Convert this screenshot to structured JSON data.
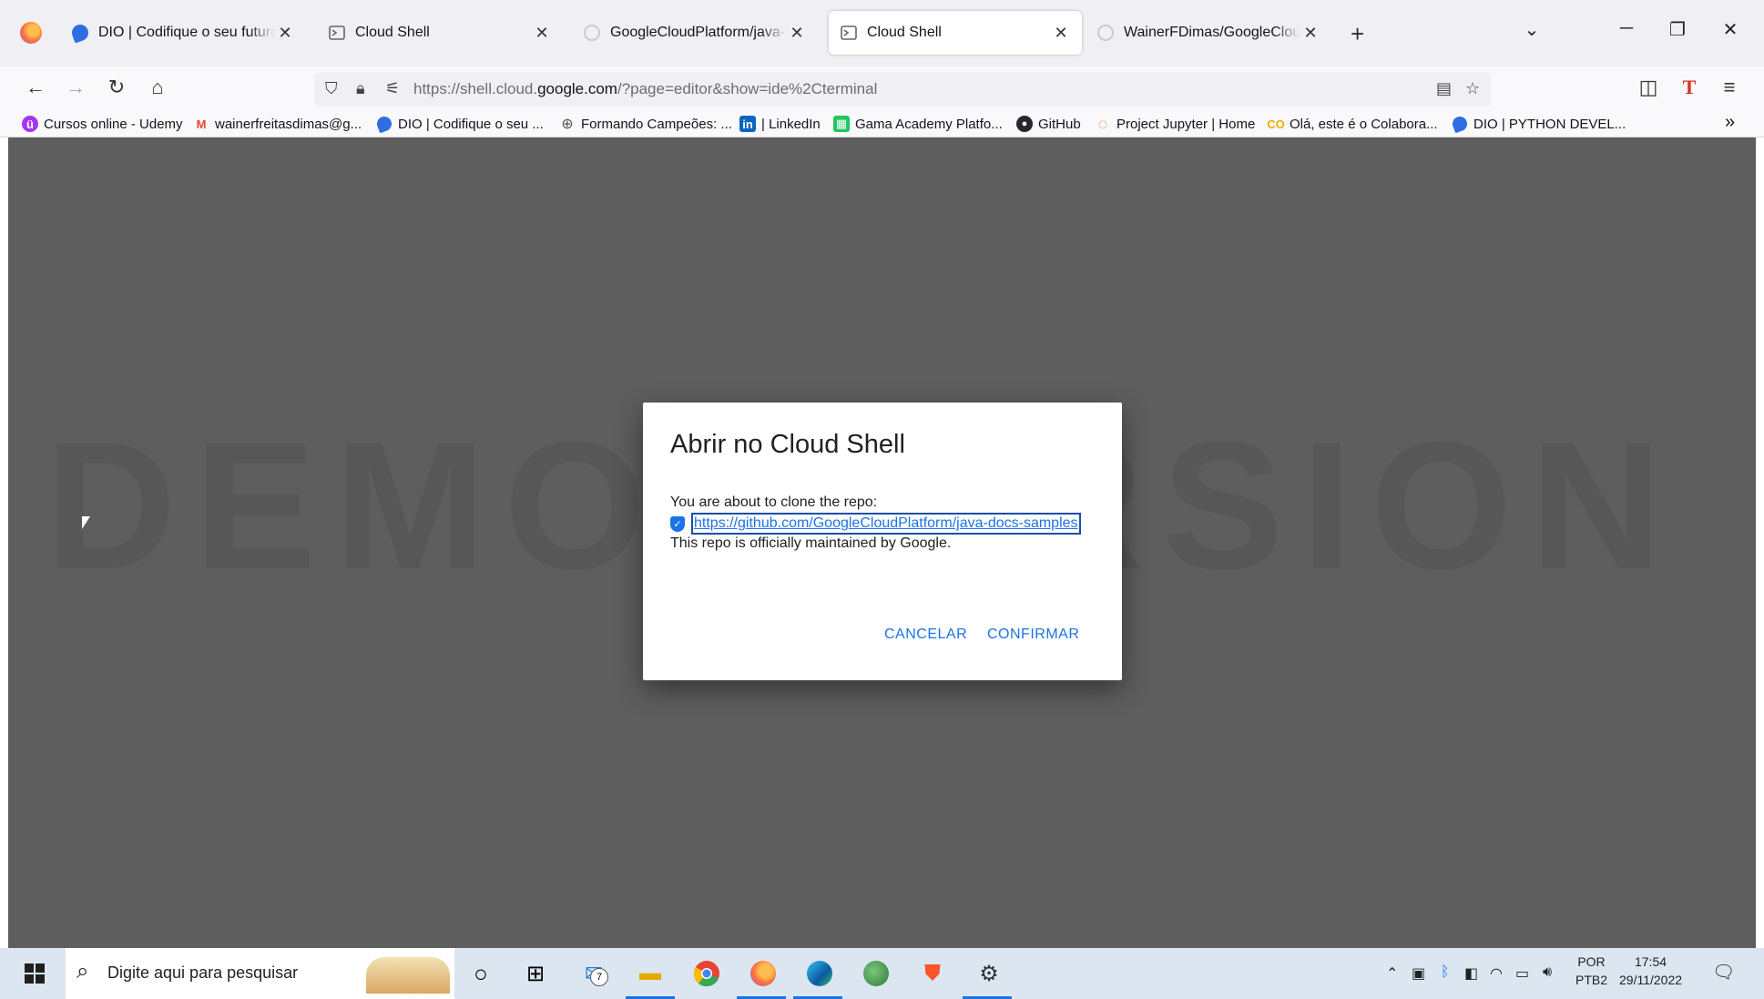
{
  "browser": {
    "tabs": [
      {
        "title": "DIO | Codifique o seu futuro global agora",
        "favicon": "dio-icon",
        "active": false
      },
      {
        "title": "Cloud Shell",
        "favicon": "cloud-shell-icon",
        "active": false
      },
      {
        "title": "GoogleCloudPlatform/java-docs-samples",
        "favicon": "github-icon",
        "active": false
      },
      {
        "title": "Cloud Shell",
        "favicon": "cloud-shell-icon",
        "active": true
      },
      {
        "title": "WainerFDimas/GoogleCloudPlatform",
        "favicon": "github-icon",
        "active": false
      }
    ],
    "new_tab": "+",
    "url_prefix": "https://shell.cloud.",
    "url_domain": "google.com",
    "url_suffix": "/?page=editor&show=ide%2Cterminal",
    "bookmarks": [
      {
        "label": "Cursos online - Udemy",
        "icon": "udemy-icon",
        "color": "#a435f0"
      },
      {
        "label": "wainerfreitasdimas@g...",
        "icon": "gmail-icon",
        "color": "#ea4335"
      },
      {
        "label": "DIO | Codifique o seu ...",
        "icon": "dio-icon",
        "color": "#2f6de1"
      },
      {
        "label": "Formando Campeões: ...",
        "icon": "globe-icon",
        "color": "#555555"
      },
      {
        "label": "| LinkedIn",
        "icon": "linkedin-icon",
        "color": "#0a66c2"
      },
      {
        "label": "Gama Academy Platfo...",
        "icon": "gama-icon",
        "color": "#22c55e"
      },
      {
        "label": "GitHub",
        "icon": "github-icon",
        "color": "#24292f"
      },
      {
        "label": "Project Jupyter | Home",
        "icon": "jupyter-icon",
        "color": "#f37626"
      },
      {
        "label": "Olá, este é o Colabora...",
        "icon": "colab-icon",
        "color": "#f9ab00"
      },
      {
        "label": "DIO | PYTHON DEVEL...",
        "icon": "dio-icon",
        "color": "#2f6de1"
      }
    ]
  },
  "dialog": {
    "title": "Abrir no Cloud Shell",
    "subtitle": "You are about to clone the repo:",
    "repo_url": "https://github.com/GoogleCloudPlatform/java-docs-samples",
    "note": "This repo is officially maintained by Google.",
    "cancel_label": "CANCELAR",
    "confirm_label": "CONFIRMAR"
  },
  "watermark": "DEMO VERSION",
  "taskbar": {
    "search_placeholder": "Digite aqui para pesquisar",
    "mail_badge": "7",
    "lang_top": "POR",
    "lang_bottom": "PTB2",
    "time": "17:54",
    "date": "29/11/2022"
  },
  "colors": {
    "accent": "#1a73e8",
    "overlay": "#5e5e5e",
    "taskbar": "#dbe6f1"
  }
}
